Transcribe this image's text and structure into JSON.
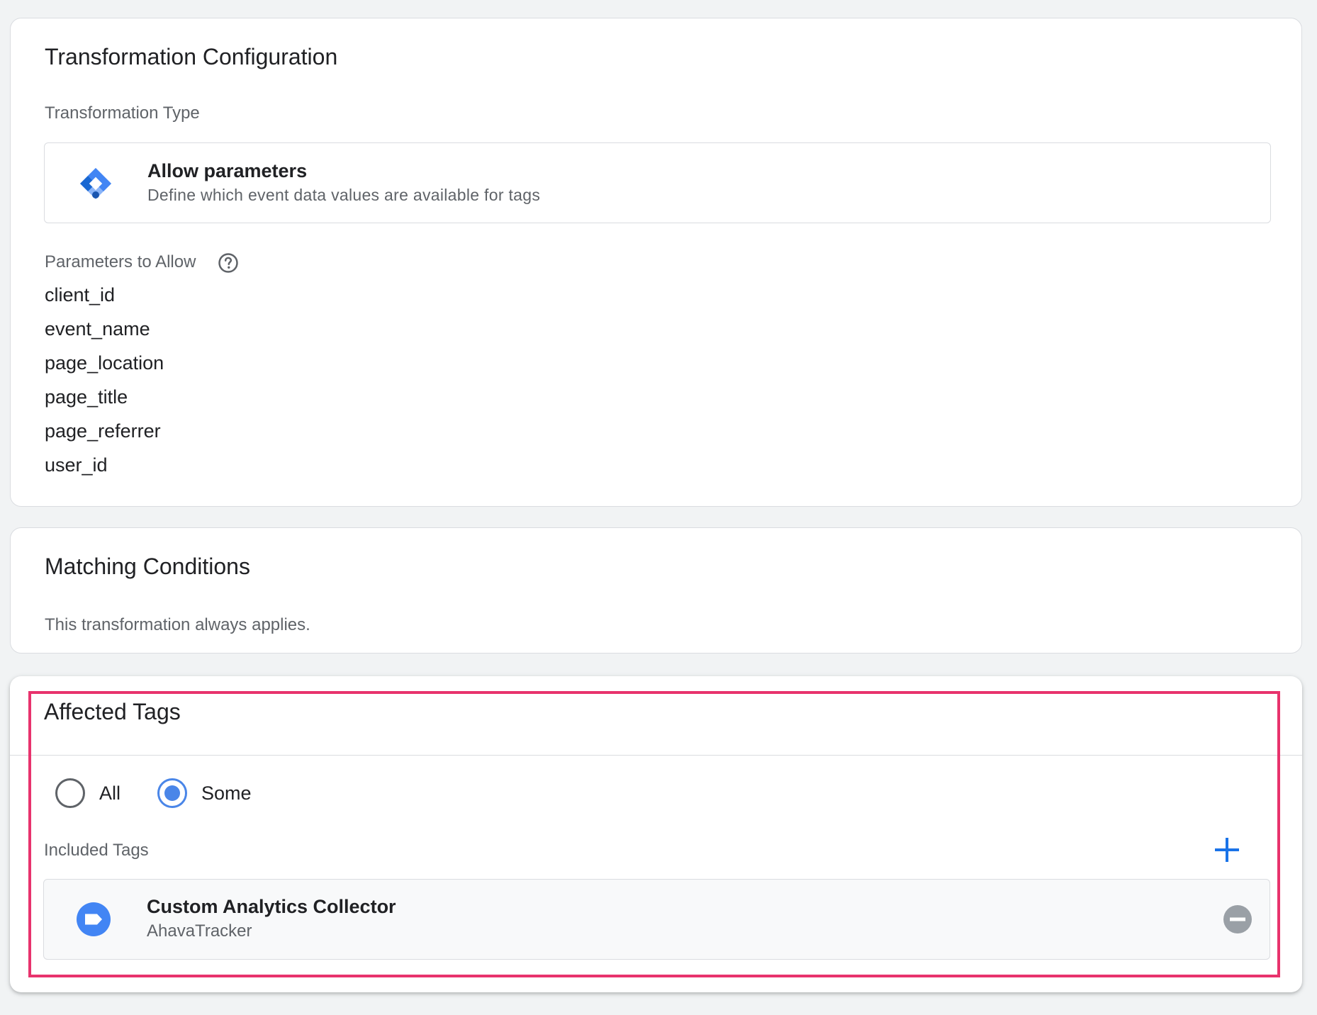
{
  "transformation_config": {
    "title": "Transformation Configuration",
    "type_label": "Transformation Type",
    "type": {
      "icon": "diamond-icon",
      "title": "Allow parameters",
      "description": "Define which event data values are available for tags"
    },
    "params_label": "Parameters to Allow",
    "params_help_icon": "help-circle-icon",
    "params": [
      "client_id",
      "event_name",
      "page_location",
      "page_title",
      "page_referrer",
      "user_id"
    ]
  },
  "matching_conditions": {
    "title": "Matching Conditions",
    "description": "This transformation always applies."
  },
  "affected_tags": {
    "title": "Affected Tags",
    "radio_options": [
      {
        "label": "All",
        "checked": false
      },
      {
        "label": "Some",
        "checked": true
      }
    ],
    "included_label": "Included Tags",
    "add_icon": "plus-icon",
    "tags": [
      {
        "icon": "tag-icon",
        "name": "Custom Analytics Collector",
        "type": "AhavaTracker",
        "remove_icon": "remove-circle-icon"
      }
    ]
  },
  "colors": {
    "accent": "#4a86e8",
    "highlight": "#e8336d",
    "text_primary": "#202124",
    "text_secondary": "#5f6368",
    "border": "#dadce0",
    "background": "#f1f3f4"
  }
}
